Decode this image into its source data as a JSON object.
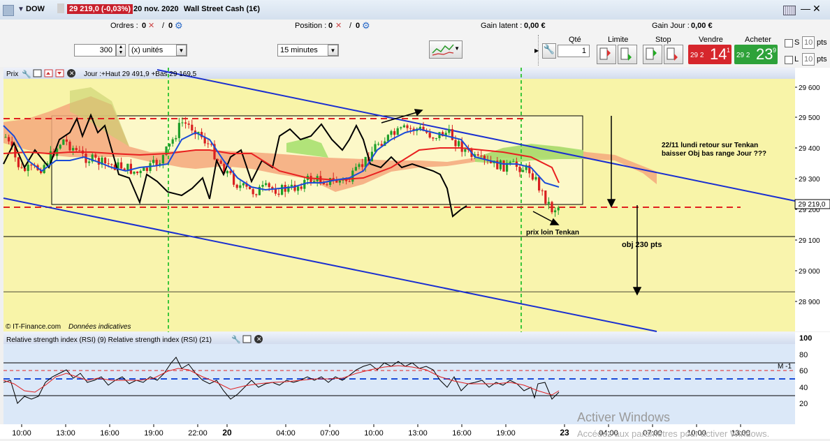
{
  "title": {
    "symbol": "DOW",
    "price_badge": "29 219,0 (-0,03%)",
    "date": "20 nov. 2020",
    "instrument": "Wall Street Cash (1€)"
  },
  "info": {
    "orders_label": "Ordres :",
    "orders_value": "0",
    "orders_value2": "0",
    "position_label": "Position :",
    "position_value": "0",
    "position_value2": "0",
    "gain_latent_label": "Gain latent :",
    "gain_latent_value": "0,00 €",
    "gain_jour_label": "Gain Jour :",
    "gain_jour_value": "0,00 €"
  },
  "toolbar": {
    "quantity": "300",
    "unit": "(x) unités",
    "timeframe": "15 minutes"
  },
  "order_panel": {
    "qty_label": "Qté",
    "qty_value": "1",
    "limit_label": "Limite",
    "stop_label": "Stop",
    "sell_label": "Vendre",
    "buy_label": "Acheter",
    "sell_prefix": "29 2",
    "sell_big": "14",
    "sell_small": "1",
    "buy_prefix": "29 2",
    "buy_big": "23",
    "buy_small": "9",
    "s_label": "S",
    "l_label": "L",
    "s_value": "10",
    "l_value": "10",
    "pts_label": "pts"
  },
  "chart": {
    "header_label": "Prix",
    "header_info": "Jour :+Haut 29 491,9 +Bas 29 169,5",
    "y_ticks": [
      "29 600",
      "29 500",
      "29 400",
      "29 300",
      "29 200",
      "29 100",
      "29 000",
      "28 900"
    ],
    "last_price": "29 219,0",
    "annotation_1": "22/11  lundi retour sur Tenkan",
    "annotation_2": "baisser Obj  bas range Jour  ???",
    "annotation_3": "prix loin Tenkan",
    "annotation_4": "obj  230 pts",
    "copyright": "© IT-Finance.com",
    "copyright_note": "Données indicatives",
    "x_ticks": [
      "10:00",
      "13:00",
      "16:00",
      "19:00",
      "22:00",
      "20",
      "04:00",
      "07:00",
      "10:00",
      "13:00",
      "16:00",
      "19:00",
      "23",
      "04:00",
      "07:00",
      "10:00",
      "13:00"
    ]
  },
  "rsi": {
    "header": "Relative strength index (RSI) (9) Relative strength index (RSI) (21)",
    "y_ticks": [
      "100",
      "80",
      "60",
      "40",
      "20"
    ],
    "marker": "M -1"
  },
  "watermark": {
    "line1": "Activer Windows",
    "line2": "Accédez aux paramètres pour activer Windows."
  },
  "colors": {
    "price_badge": "#c8202c",
    "sell": "#d6262c",
    "buy": "#2ea23a",
    "trend_line": "#1a2fd0",
    "range_line": "#e02020",
    "session_line": "#3cc63c"
  }
}
